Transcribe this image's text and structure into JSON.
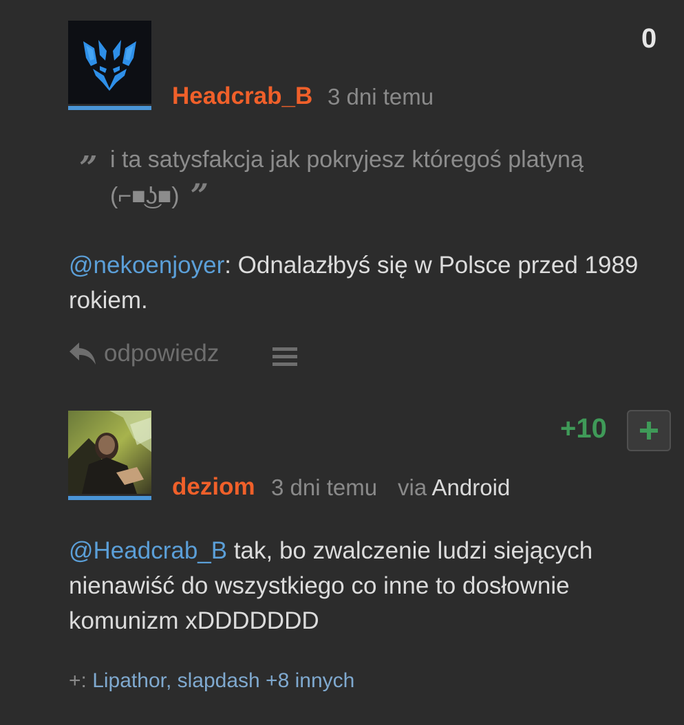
{
  "comments": [
    {
      "author": "Headcrab_B",
      "time": "3 dni temu",
      "score": "0",
      "score_color": "#e6e6e6",
      "avatar_icon": "wolf-logo-icon",
      "quote": {
        "open_mark": "„",
        "close_mark": "”",
        "text": "i ta satysfakcja jak pokryjesz któregoś platyną (⌐■͜ʖ■)"
      },
      "body": {
        "mention": "@nekoenjoyer",
        "text": ": Odnalazłbyś się w Polsce przed 1989 rokiem."
      },
      "actions": {
        "reply_label": "odpowiedz",
        "reply_icon": "reply-arrow-icon",
        "menu_icon": "hamburger-menu-icon"
      }
    },
    {
      "author": "deziom",
      "time": "3 dni temu",
      "via_prefix": "via",
      "via_platform": "Android",
      "score": "+10",
      "score_color": "#3f9a58",
      "avatar_icon": "user-photo-avatar",
      "plus_icon": "plus-icon",
      "body": {
        "mention": "@Headcrab_B",
        "text": " tak, bo zwalczenie ludzi siejących nienawiść do wszystkiego co inne to dosłownie komunizm xDDDDDDD"
      },
      "voters": {
        "prefix": "+: ",
        "names": "Lipathor, slapdash",
        "others": " +8 innych"
      }
    }
  ],
  "colors": {
    "background": "#2c2c2c",
    "author": "#f0602a",
    "mention": "#5b9fd8",
    "avatar_underline": "#4a95d6"
  }
}
